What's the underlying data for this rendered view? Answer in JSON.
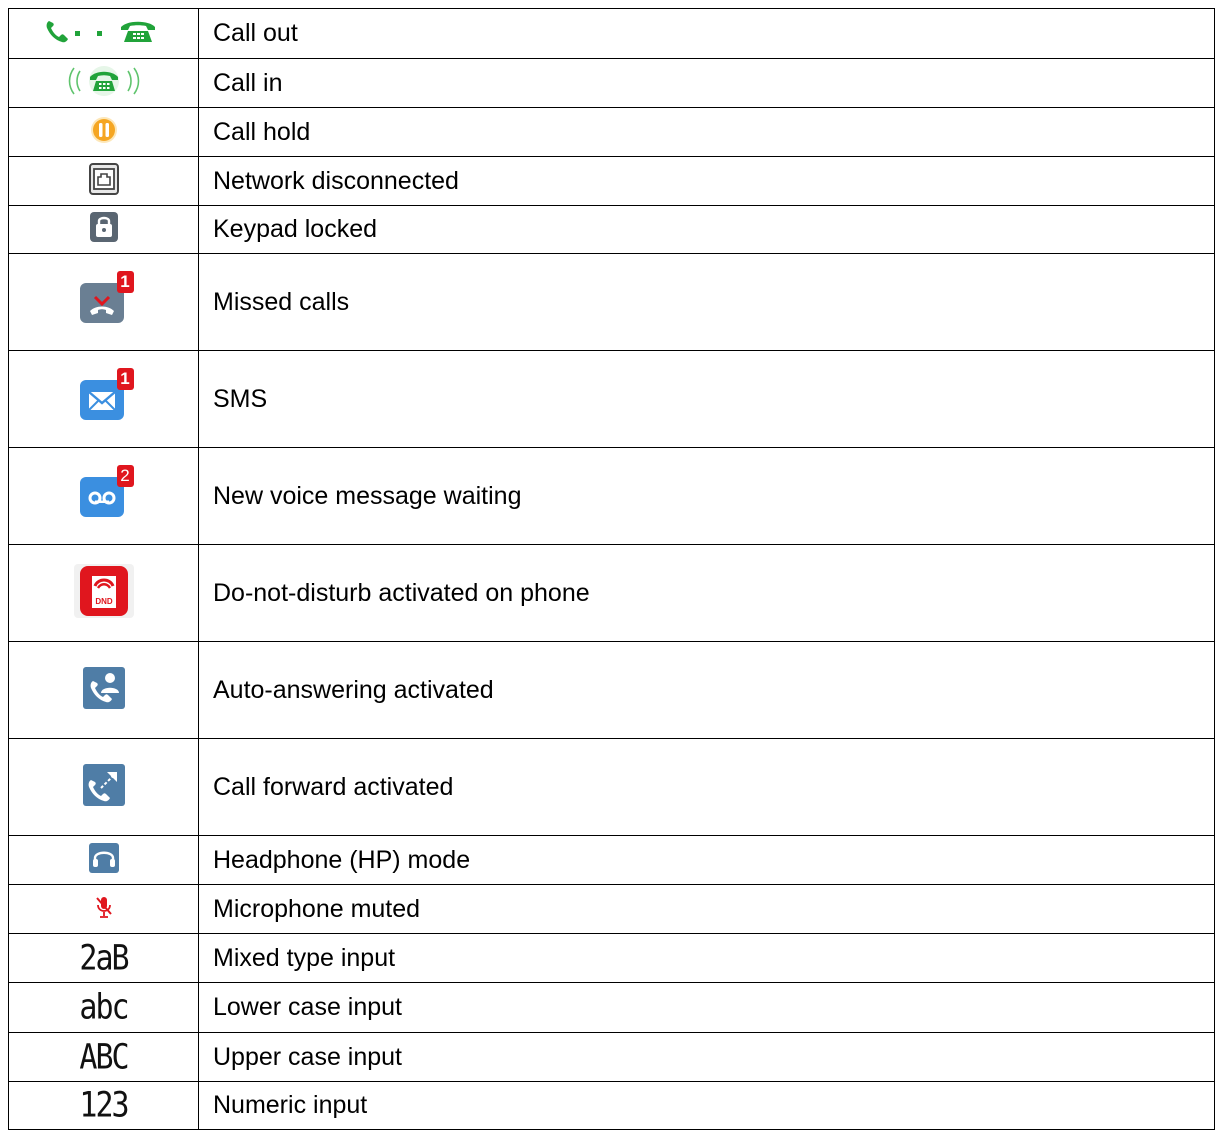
{
  "rows": [
    {
      "icon": "call-out-icon",
      "label": "Call out"
    },
    {
      "icon": "call-in-icon",
      "label": "Call in"
    },
    {
      "icon": "call-hold-icon",
      "label": "Call hold"
    },
    {
      "icon": "network-disconnected-icon",
      "label": "Network disconnected"
    },
    {
      "icon": "keypad-locked-icon",
      "label": "Keypad locked"
    },
    {
      "icon": "missed-calls-icon",
      "label": "Missed calls",
      "badge": "1"
    },
    {
      "icon": "sms-icon",
      "label": "SMS",
      "badge": "1"
    },
    {
      "icon": "voice-message-icon",
      "label": "New voice message waiting",
      "badge": "2"
    },
    {
      "icon": "dnd-icon",
      "label": "Do-not-disturb activated on phone",
      "icon_text": "DND"
    },
    {
      "icon": "auto-answer-icon",
      "label": "Auto-answering activated"
    },
    {
      "icon": "call-forward-icon",
      "label": "Call forward activated"
    },
    {
      "icon": "headphone-icon",
      "label": "Headphone (HP) mode"
    },
    {
      "icon": "microphone-muted-icon",
      "label": "Microphone muted"
    },
    {
      "icon": "mixed-input-icon",
      "label": "Mixed type input",
      "icon_text": "2aB"
    },
    {
      "icon": "lower-case-input-icon",
      "label": "Lower case input",
      "icon_text": "abc"
    },
    {
      "icon": "upper-case-input-icon",
      "label": "Upper case input",
      "icon_text": "ABC"
    },
    {
      "icon": "numeric-input-icon",
      "label": "Numeric input",
      "icon_text": "123"
    }
  ],
  "colors": {
    "green": "#21a33a",
    "orange": "#f5a623",
    "gray_blue": "#6a7f93",
    "blue": "#3b8fe0",
    "red": "#e0161e",
    "slate": "#4f7da6"
  }
}
